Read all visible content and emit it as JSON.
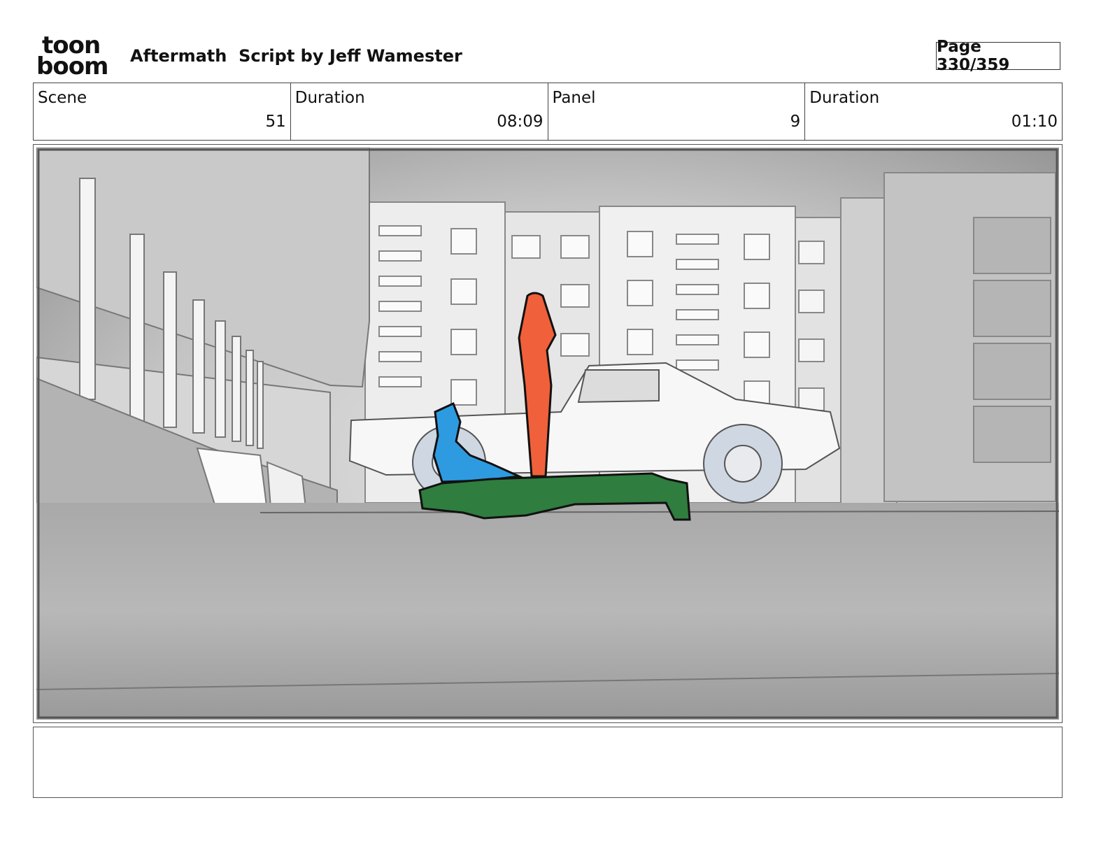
{
  "header": {
    "logo_top": "toon",
    "logo_bottom": "boom",
    "title": "Aftermath  Script by Jeff Wamester",
    "page": "Page 330/359"
  },
  "info": [
    {
      "label": "Scene",
      "value": "51"
    },
    {
      "label": "Duration",
      "value": "08:09"
    },
    {
      "label": "Panel",
      "value": "9"
    },
    {
      "label": "Duration",
      "value": "01:10"
    }
  ],
  "notes": "",
  "colors": {
    "standing_figure": "#f0603a",
    "kneeling_figure": "#2e9be0",
    "lying_figure": "#2f7d3f",
    "background": "#bdbdbd"
  }
}
